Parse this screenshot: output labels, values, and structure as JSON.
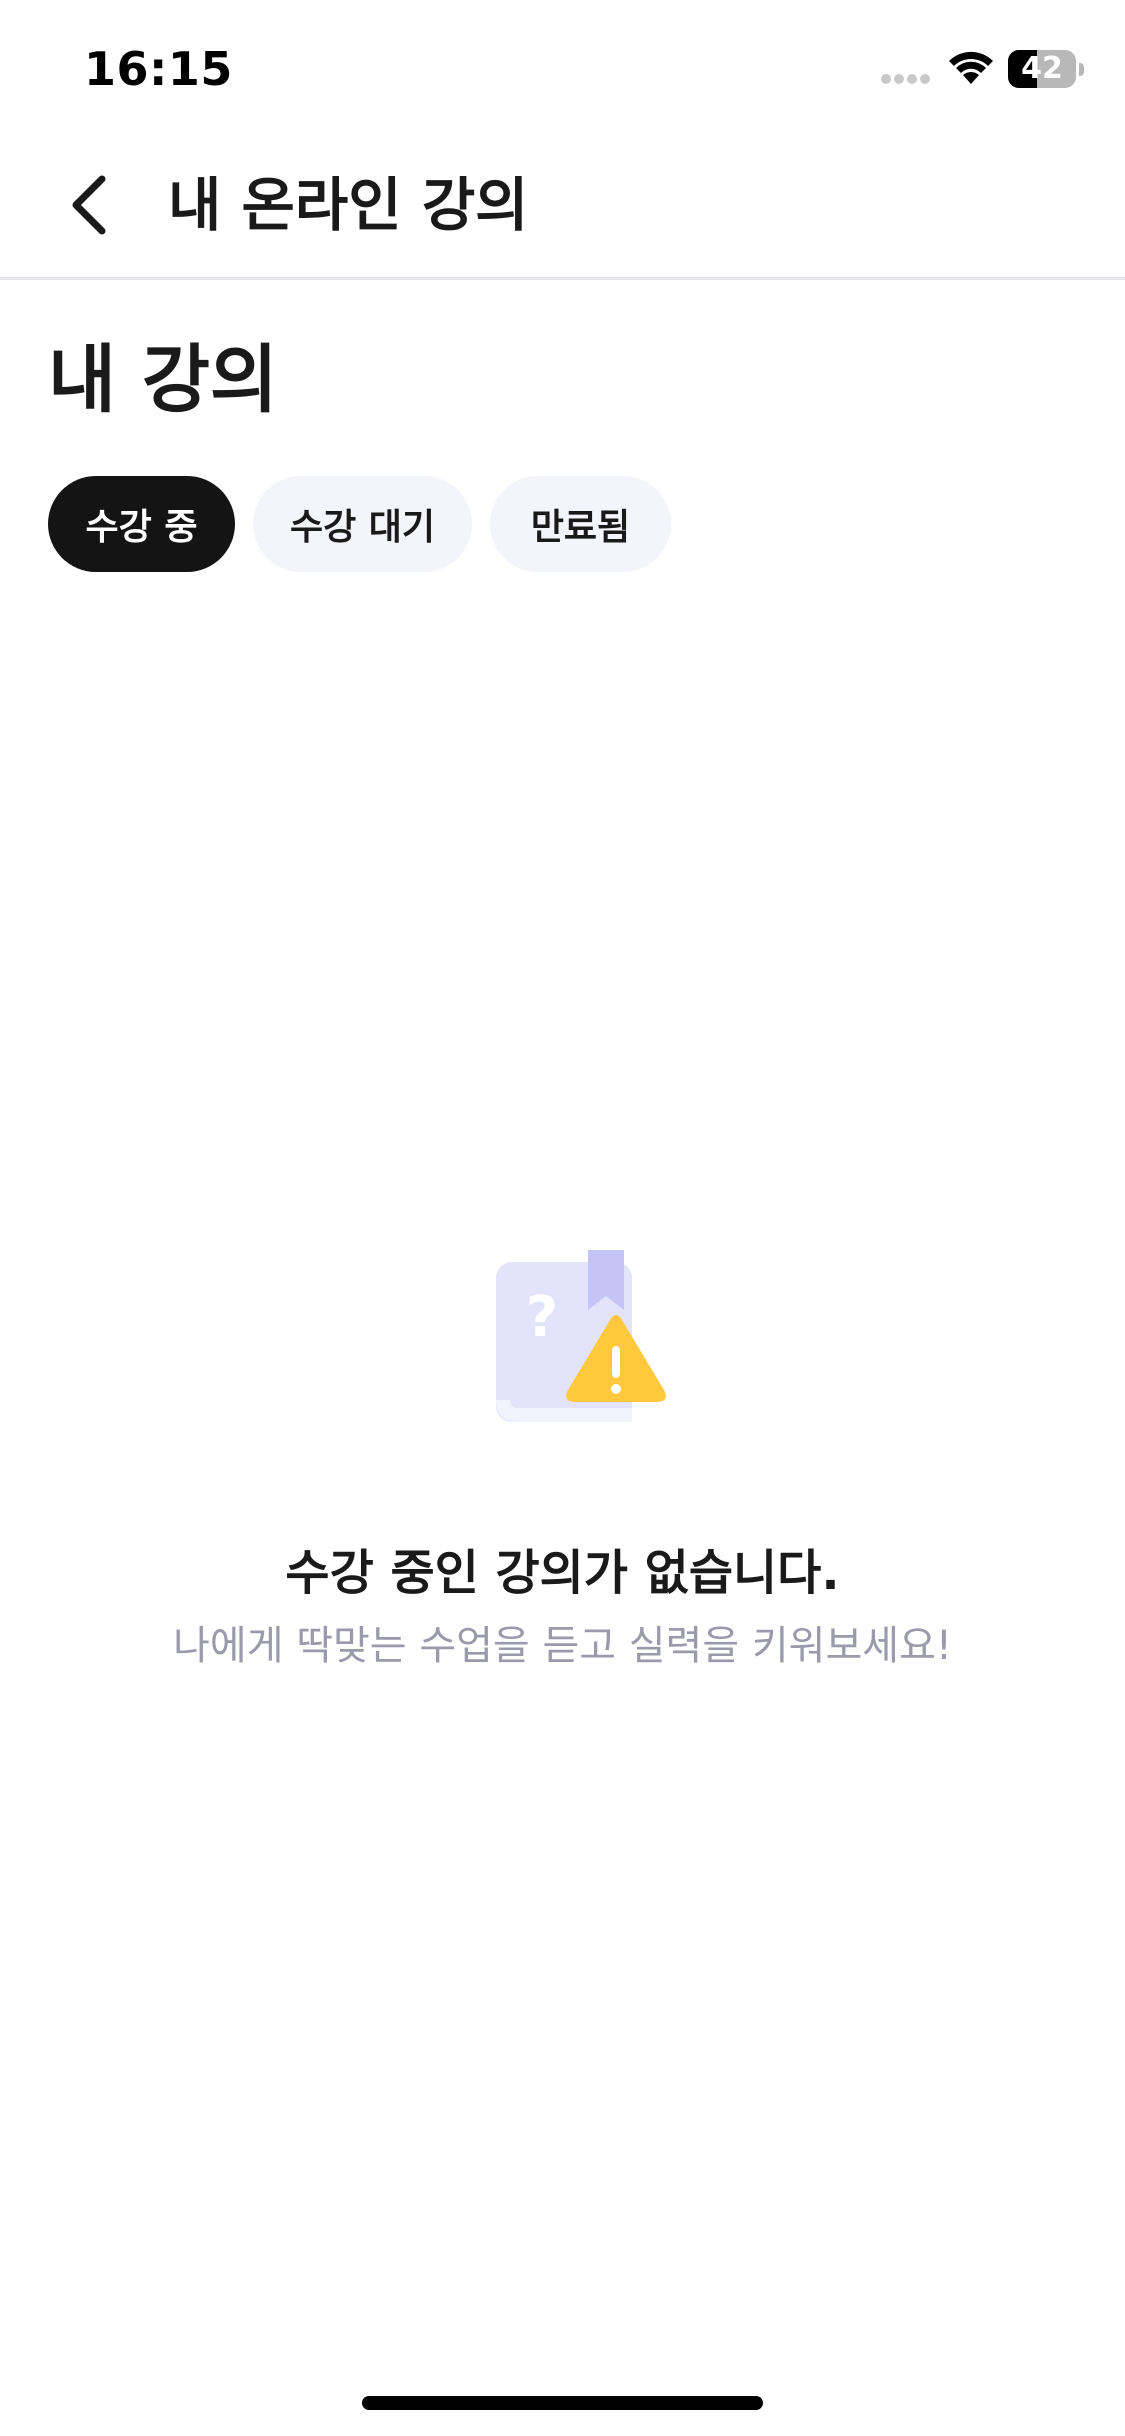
{
  "status_bar": {
    "time": "16:15",
    "battery_level": "42",
    "battery_fraction": 0.42
  },
  "header": {
    "back_icon": "chevron-left-icon",
    "title": "내 온라인 강의"
  },
  "section": {
    "title": "내 강의"
  },
  "tabs": [
    {
      "label": "수강 중",
      "selected": true
    },
    {
      "label": "수강 대기",
      "selected": false
    },
    {
      "label": "만료됨",
      "selected": false
    }
  ],
  "empty_state": {
    "icon": "book-warning-icon",
    "title": "수강 중인 강의가 없습니다.",
    "subtitle": "나에게 딱맞는 수업을 듣고 실력을 키워보세요!"
  },
  "colors": {
    "active_tab_bg": "#141414",
    "inactive_tab_bg": "#f4f4fb",
    "subtitle_text": "#9a9aab",
    "illustration_book": "#e3e3fb",
    "illustration_bookmark": "#c4c4f7",
    "illustration_warning": "#ffc83d"
  }
}
